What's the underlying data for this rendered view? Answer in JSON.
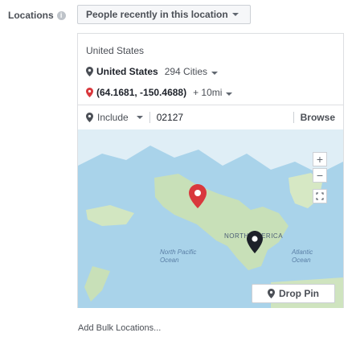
{
  "header": {
    "label": "Locations",
    "audience_select": "People recently in this location"
  },
  "panel": {
    "country_header": "United States",
    "selected_country": {
      "name": "United States",
      "cities": "294 Cities"
    },
    "selected_point": {
      "coords": "(64.1681, -150.4688)",
      "radius": "+ 10mi"
    },
    "include_label": "Include",
    "search_value": "02127",
    "browse_label": "Browse"
  },
  "map": {
    "label_north_america": "NORTH AMERICA",
    "label_north_pacific": "North Pacific Ocean",
    "label_atlantic": "Atlantic Ocean",
    "zoom_in": "+",
    "zoom_out": "−",
    "drop_pin_label": "Drop Pin"
  },
  "footer": {
    "bulk_link": "Add Bulk Locations..."
  },
  "colors": {
    "pin_red": "#d9383d",
    "pin_dark": "#1d2129",
    "water": "#a9d3ea",
    "land": "#c8e0b8"
  }
}
